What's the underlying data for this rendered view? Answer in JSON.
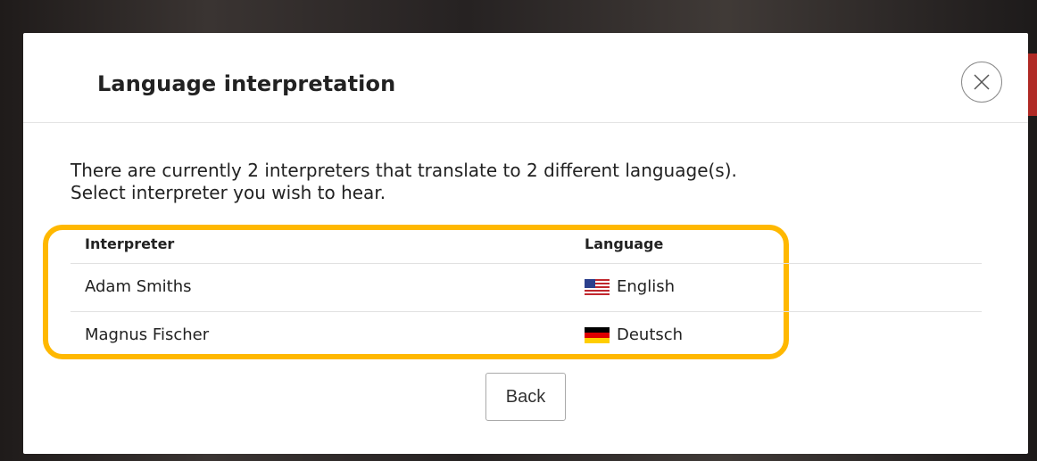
{
  "dialog": {
    "title": "Language interpretation",
    "close_icon": "close-circle-icon"
  },
  "info": {
    "line1": "There are currently 2 interpreters that translate to 2 different language(s).",
    "line2": "Select interpreter you wish to hear."
  },
  "table": {
    "columns": [
      "Interpreter",
      "Language"
    ],
    "rows": [
      {
        "interpreter": "Adam Smiths",
        "language": "English",
        "flag_icon": "us-flag-icon"
      },
      {
        "interpreter": "Magnus Fischer",
        "language": "Deutsch",
        "flag_icon": "germany-flag-icon"
      }
    ]
  },
  "highlight_color": "#ffb800",
  "back_button": {
    "label": "Back"
  }
}
